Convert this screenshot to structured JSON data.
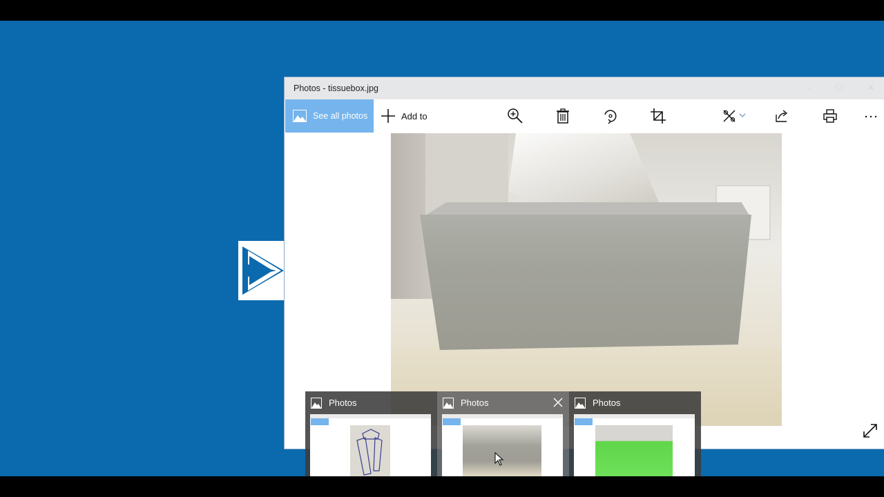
{
  "window": {
    "title": "Photos - tissuebox.jpg",
    "controls": {
      "minimize": "–",
      "maximize": "☐",
      "close": "✕"
    }
  },
  "toolbar": {
    "see_all_photos": "See all photos",
    "add_to": "Add to",
    "icons": [
      "zoom-in-icon",
      "delete-icon",
      "rotate-icon",
      "crop-icon",
      "edit-create-icon",
      "share-icon",
      "print-icon",
      "more-icon"
    ]
  },
  "photo": {
    "subject": "tissue box"
  },
  "taskbar_previews": [
    {
      "label": "Photos",
      "thumbnail": "sketch drawing",
      "active": false
    },
    {
      "label": "Photos",
      "thumbnail": "tissue box",
      "active": true
    },
    {
      "label": "Photos",
      "thumbnail": "green towel",
      "active": false
    }
  ],
  "colors": {
    "desktop": "#0b69ad",
    "accent": "#75b4ec",
    "titlebar": "#e6e7e8"
  }
}
